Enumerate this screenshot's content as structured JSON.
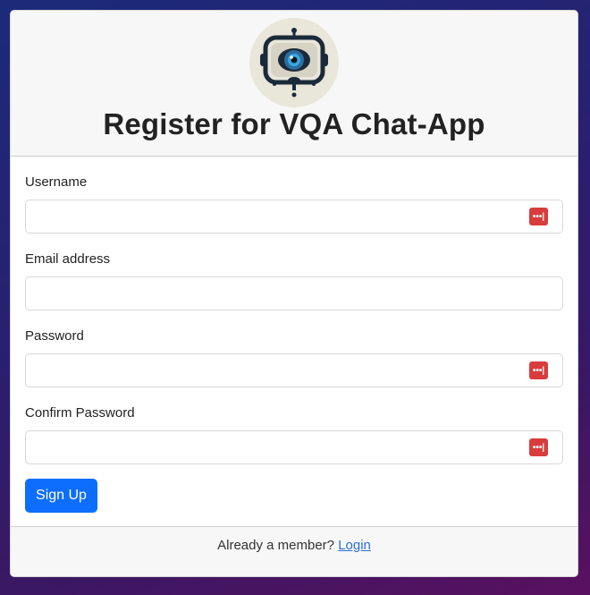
{
  "header": {
    "title": "Register for VQA Chat-App"
  },
  "form": {
    "username_label": "Username",
    "email_label": "Email address",
    "password_label": "Password",
    "confirm_label": "Confirm Password",
    "submit_label": "Sign Up"
  },
  "footer": {
    "prompt": "Already a member?",
    "login_label": "Login"
  },
  "colors": {
    "primary": "#0d6efd",
    "password_manager_icon": "#d93c3c"
  },
  "icons": {
    "logo": "eye-camera-logo-icon",
    "password_manager": "password-manager-icon"
  }
}
